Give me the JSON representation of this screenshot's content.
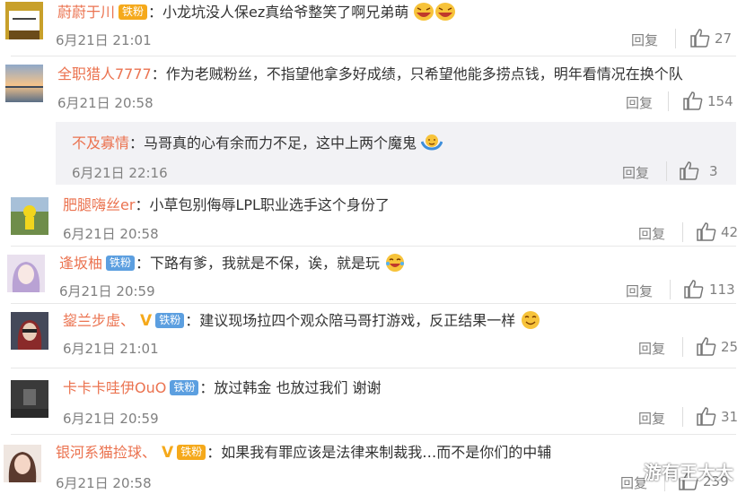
{
  "comments": [
    {
      "user": "蔚蔚于川",
      "badge": "铁粉",
      "badge_style": "gold",
      "text": "小龙坑没人保ez真给爷整笑了啊兄弟萌",
      "emoji": [
        "laugh-icon",
        "laugh-icon"
      ],
      "time": "6月21日 21:01",
      "reply": "回复",
      "likes": "27"
    },
    {
      "user": "全职猎人7777",
      "text": "作为老贼粉丝，不指望他拿多好成绩，只希望他能多捞点钱，明年看情况在换个队",
      "time": "6月21日 20:58",
      "reply": "回复",
      "likes": "154"
    },
    {
      "user": "不及寡情",
      "text": "马哥真的心有余而力不足，这中上两个魔鬼",
      "emoji": [
        "shrug-icon"
      ],
      "time": "6月21日 22:16",
      "reply": "回复",
      "likes": "3"
    },
    {
      "user": "肥腿嗨丝er",
      "text": "小草包别侮辱LPL职业选手这个身份了",
      "time": "6月21日 20:58",
      "reply": "回复",
      "likes": "42"
    },
    {
      "user": "逢坂柚",
      "badge": "铁粉",
      "text": "下路有爹，我就是不保，诶，就是玩",
      "emoji": [
        "laugh-tears-icon"
      ],
      "time": "6月21日 20:59",
      "reply": "回复",
      "likes": "113"
    },
    {
      "user": "鋆兰步虚、",
      "vip": "V",
      "badge": "铁粉",
      "text": "建议现场拉四个观众陪马哥打游戏，反正结果一样",
      "emoji": [
        "smile-icon"
      ],
      "time": "6月21日 21:01",
      "reply": "回复",
      "likes": "25"
    },
    {
      "user": "卡卡卡哇伊OuO",
      "badge": "铁粉",
      "text": "放过韩金 也放过我们 谢谢",
      "time": "6月21日 20:59",
      "reply": "回复",
      "likes": "31"
    },
    {
      "user": "银河系猫捡球、",
      "vip": "V",
      "badge": "铁粉",
      "badge_style": "gold",
      "text": "如果我有罪应该是法律来制裁我…而不是你们的中辅",
      "time": "6月21日 20:58",
      "reply": "回复",
      "likes": "239"
    }
  ],
  "watermark": "游有王大大",
  "colors": {
    "username": "#eb7350",
    "badge_blue": "#5c9fe0",
    "badge_gold": "#f5a91b",
    "meta_gray": "#808080"
  }
}
